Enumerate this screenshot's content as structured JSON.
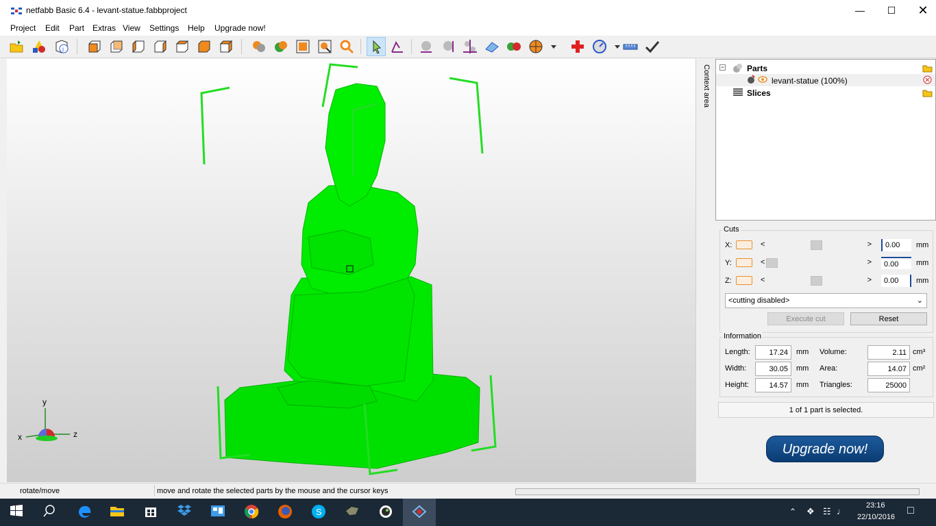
{
  "window": {
    "title": "netfabb Basic 6.4 - levant-statue.fabbproject",
    "controls": [
      "minimize",
      "maximize",
      "close"
    ]
  },
  "menu": [
    "Project",
    "Edit",
    "Part",
    "Extras",
    "View",
    "Settings",
    "Help",
    "Upgrade now!"
  ],
  "toolbar_icons": [
    "open-project-icon",
    "add-part-icon",
    "part-info-icon",
    "view-front-icon",
    "view-back-icon",
    "view-left-icon",
    "view-right-icon",
    "view-top-icon",
    "view-bottom-icon",
    "view-iso-icon",
    "boolean-icon",
    "texture-icon",
    "zoom-fit-icon",
    "zoom-selection-icon",
    "zoom-icon",
    "select-arrow-icon",
    "rotate-move-icon",
    "sphere-icon",
    "spheres-icon",
    "axes-icon",
    "landscape-icon",
    "color-balls-icon",
    "pie-icon",
    "repair-cross-icon",
    "measure-dial-icon",
    "ruler-icon",
    "checkmark-icon"
  ],
  "context_area_label": "Context area",
  "tree": {
    "parts_label": "Parts",
    "part_name": "levant-statue (100%)",
    "slices_label": "Slices"
  },
  "cuts": {
    "title": "Cuts",
    "axes": [
      {
        "label": "X:",
        "value": "0.00",
        "unit": "mm",
        "slider": 0.5
      },
      {
        "label": "Y:",
        "value": "0.00",
        "unit": "mm",
        "slider": 0.0
      },
      {
        "label": "Z:",
        "value": "0.00",
        "unit": "mm",
        "slider": 0.5
      }
    ],
    "mode": "<cutting disabled>",
    "execute_label": "Execute cut",
    "reset_label": "Reset"
  },
  "information": {
    "title": "Information",
    "length_label": "Length:",
    "length": "17.24",
    "length_unit": "mm",
    "width_label": "Width:",
    "width": "30.05",
    "width_unit": "mm",
    "height_label": "Height:",
    "height": "14.57",
    "height_unit": "mm",
    "volume_label": "Volume:",
    "volume": "2.11",
    "volume_unit": "cm³",
    "area_label": "Area:",
    "area": "14.07",
    "area_unit": "cm²",
    "triangles_label": "Triangles:",
    "triangles": "25000"
  },
  "selection_status": "1 of 1 part is selected.",
  "upgrade_button": "Upgrade now!",
  "axes_widget": {
    "x": "x",
    "y": "y",
    "z": "z"
  },
  "statusbar": {
    "mode": "rotate/move",
    "hint": "move and rotate the selected parts by the mouse and the cursor keys"
  },
  "taskbar": {
    "apps": [
      "start-icon",
      "search-icon",
      "edge-icon",
      "file-explorer-icon",
      "store-icon",
      "dropbox-icon",
      "photos-icon",
      "chrome-icon",
      "firefox-icon",
      "skype-icon",
      "app-icon",
      "app2-icon",
      "netfabb-icon"
    ],
    "time": "23:16",
    "date": "22/10/2016"
  },
  "colors": {
    "model": "#00ee00",
    "frame": "#22dd22",
    "accent": "#e8902a",
    "upgrade": "#0f4580"
  }
}
